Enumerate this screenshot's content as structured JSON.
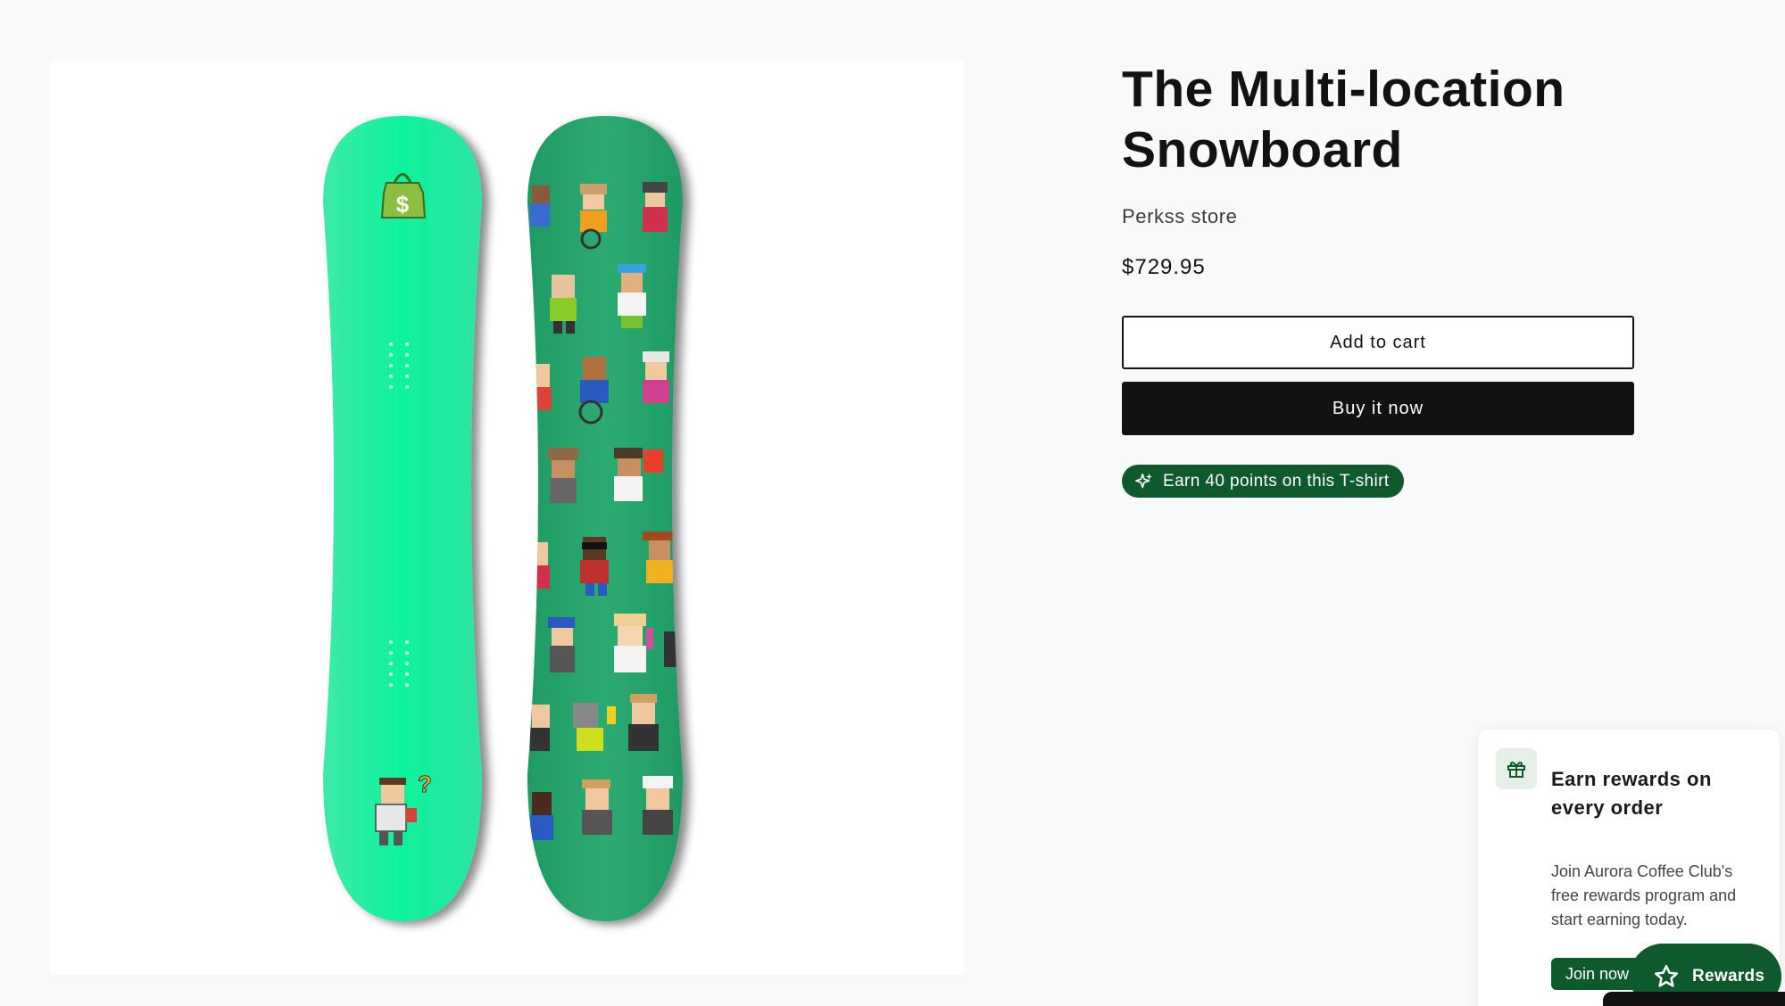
{
  "product": {
    "title": "The Multi-location Snowboard",
    "vendor": "Perkss store",
    "price": "$729.95",
    "image_alt": "Two snowboards: a mint green board and a green board with pixel-art characters"
  },
  "buttons": {
    "add_to_cart": "Add to cart",
    "buy_now": "Buy it now"
  },
  "points_badge": {
    "label": "Earn 40 points on this T-shirt",
    "icon": "sparkle-icon"
  },
  "rewards_popup": {
    "title": "Earn rewards on every order",
    "body": "Join Aurora Coffee Club's free rewards program and start earning today.",
    "join_label": "Join now",
    "icon": "gift-icon"
  },
  "rewards_launcher": {
    "label": "Rewards",
    "icon": "star-icon"
  },
  "colors": {
    "accent_green": "#0e5a2c",
    "board_mint": "#1ee89c",
    "board_green": "#23a06a",
    "button_black": "#121212"
  }
}
